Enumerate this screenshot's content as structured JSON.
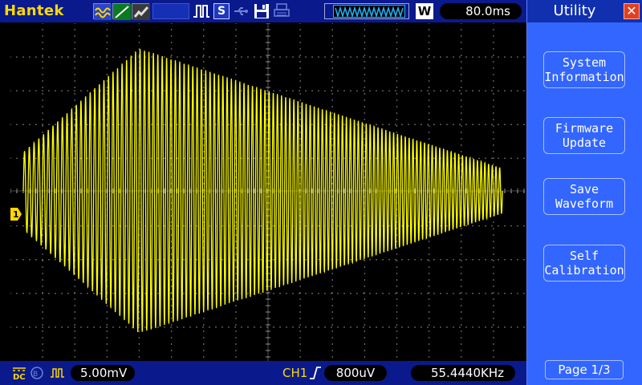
{
  "brand": "Hantek",
  "colors": {
    "trace": "#ffff00",
    "grid": "#8a8a8a",
    "bar": "#0a1a8c",
    "menu": "#3366ff",
    "marker": "#ffd800"
  },
  "icons": {
    "acquisition": [
      "wave-mode-icon",
      "line-mode-icon",
      "persistence-icon"
    ],
    "run_state": "pulse-run-icon",
    "usb": "usb-icon",
    "save": "floppy-icon",
    "print": "printer-icon"
  },
  "status": {
    "s_badge": "S",
    "window_badge": "W",
    "timebase": "80.0ms"
  },
  "channel": {
    "marker_label": "1",
    "coupling": "DC",
    "volts_div": "5.00mV"
  },
  "trigger": {
    "source": "CH1",
    "level": "800uV",
    "frequency": "55.4440KHz"
  },
  "menu": {
    "title": "Utility",
    "close_icon": "close-icon",
    "buttons": [
      {
        "line1": "System",
        "line2": "Information"
      },
      {
        "line1": "Firmware",
        "line2": "Update"
      },
      {
        "line1": "Save",
        "line2": "Waveform"
      },
      {
        "line1": "Self",
        "line2": "Calibration"
      }
    ],
    "page": "Page 1/3"
  },
  "waveform": {
    "description_kind": "amplitude-modulated sine burst",
    "cycles": 100,
    "start_fraction": 0.025,
    "end_fraction": 0.955,
    "peak_fraction": 0.25
  }
}
